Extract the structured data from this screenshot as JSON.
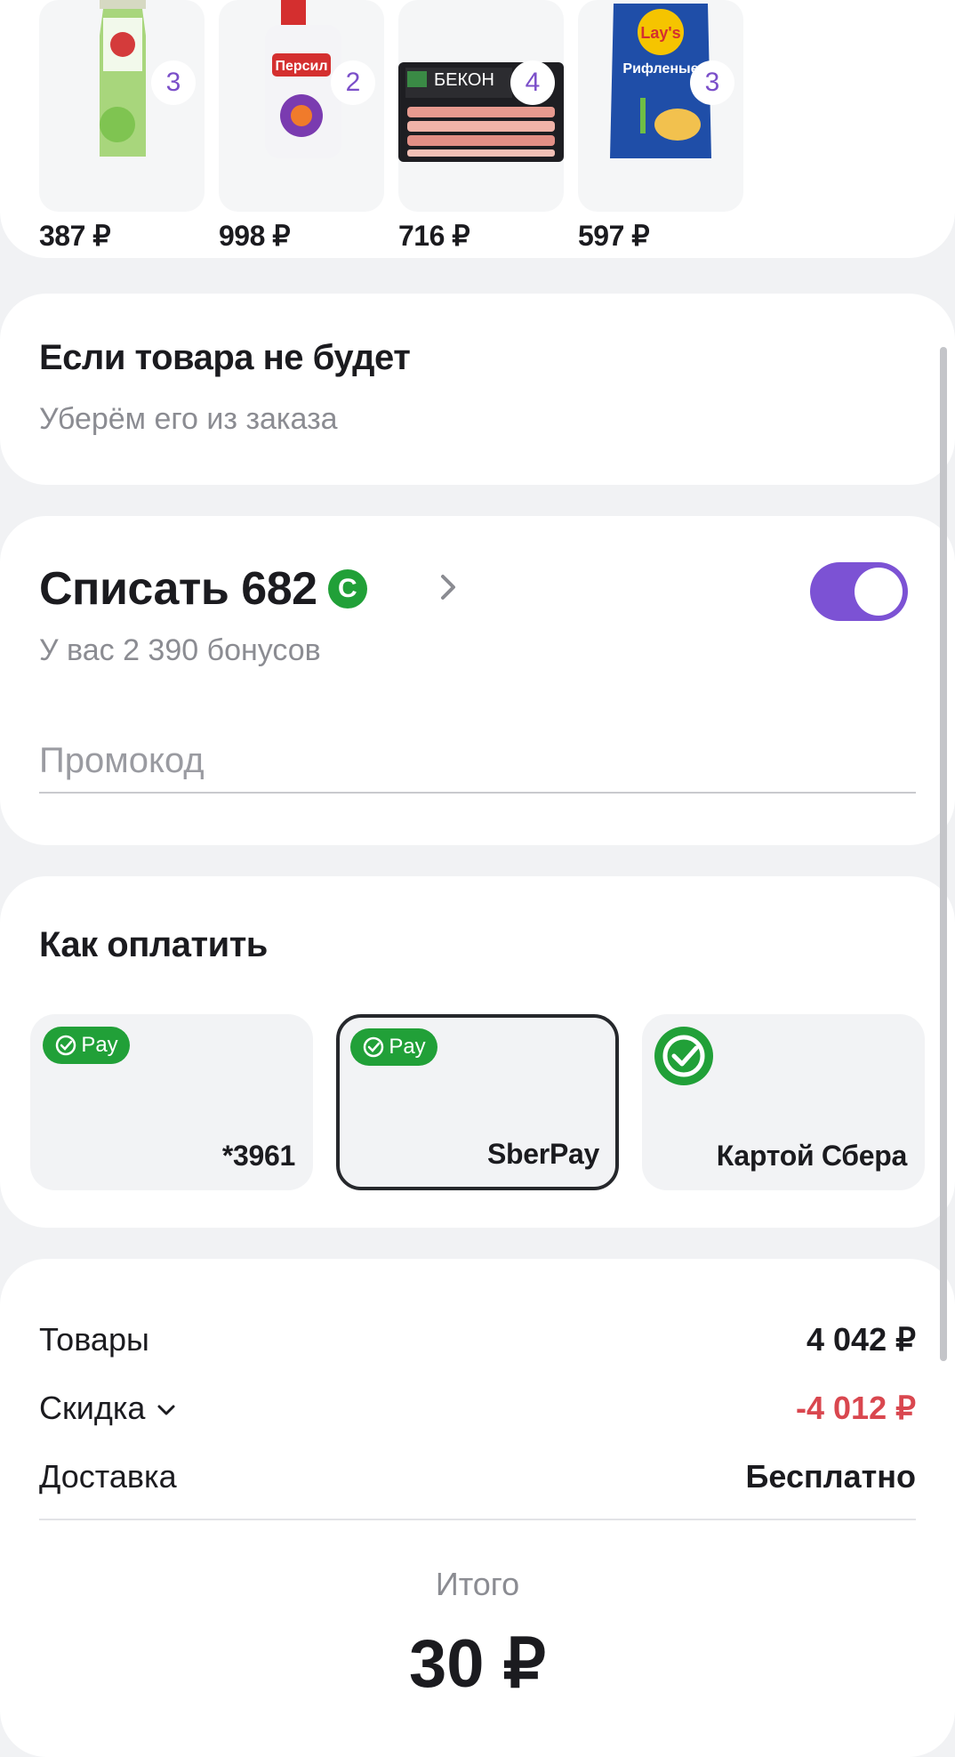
{
  "products": [
    {
      "name": "apple-juice",
      "qty": "3",
      "price": "387 ₽"
    },
    {
      "name": "persil-detergent",
      "qty": "2",
      "price": "998 ₽"
    },
    {
      "name": "bacon",
      "qty": "4",
      "price": "716 ₽"
    },
    {
      "name": "lays-chips",
      "qty": "3",
      "price": "597 ₽"
    }
  ],
  "packaging": {
    "persil": "Персил",
    "bacon": "БЕКОН",
    "lays": "Lay's",
    "lays_sub": "Рифленые"
  },
  "missing_item": {
    "title": "Если товара не будет",
    "subtitle": "Уберём его из заказа"
  },
  "bonus": {
    "title": "Списать 682",
    "coin_symbol": "С",
    "subtitle": "У вас 2 390 бонусов",
    "toggle_on": true,
    "promo_placeholder": "Промокод"
  },
  "payment": {
    "title": "Как оплатить",
    "badge_text": "Pay",
    "options": [
      {
        "label": "*3961",
        "selected": false
      },
      {
        "label": "SberPay",
        "selected": true
      },
      {
        "label": "Картой Сбера",
        "selected": false
      }
    ]
  },
  "summary": {
    "goods_label": "Товары",
    "goods_value": "4 042 ₽",
    "discount_label": "Скидка",
    "discount_value": "-4 012 ₽",
    "delivery_label": "Доставка",
    "delivery_value": "Бесплатно",
    "total_label": "Итого",
    "total_value": "30 ₽"
  },
  "colors": {
    "accent_purple": "#7c52d4",
    "sber_green": "#21a038",
    "discount_red": "#d9474f"
  }
}
